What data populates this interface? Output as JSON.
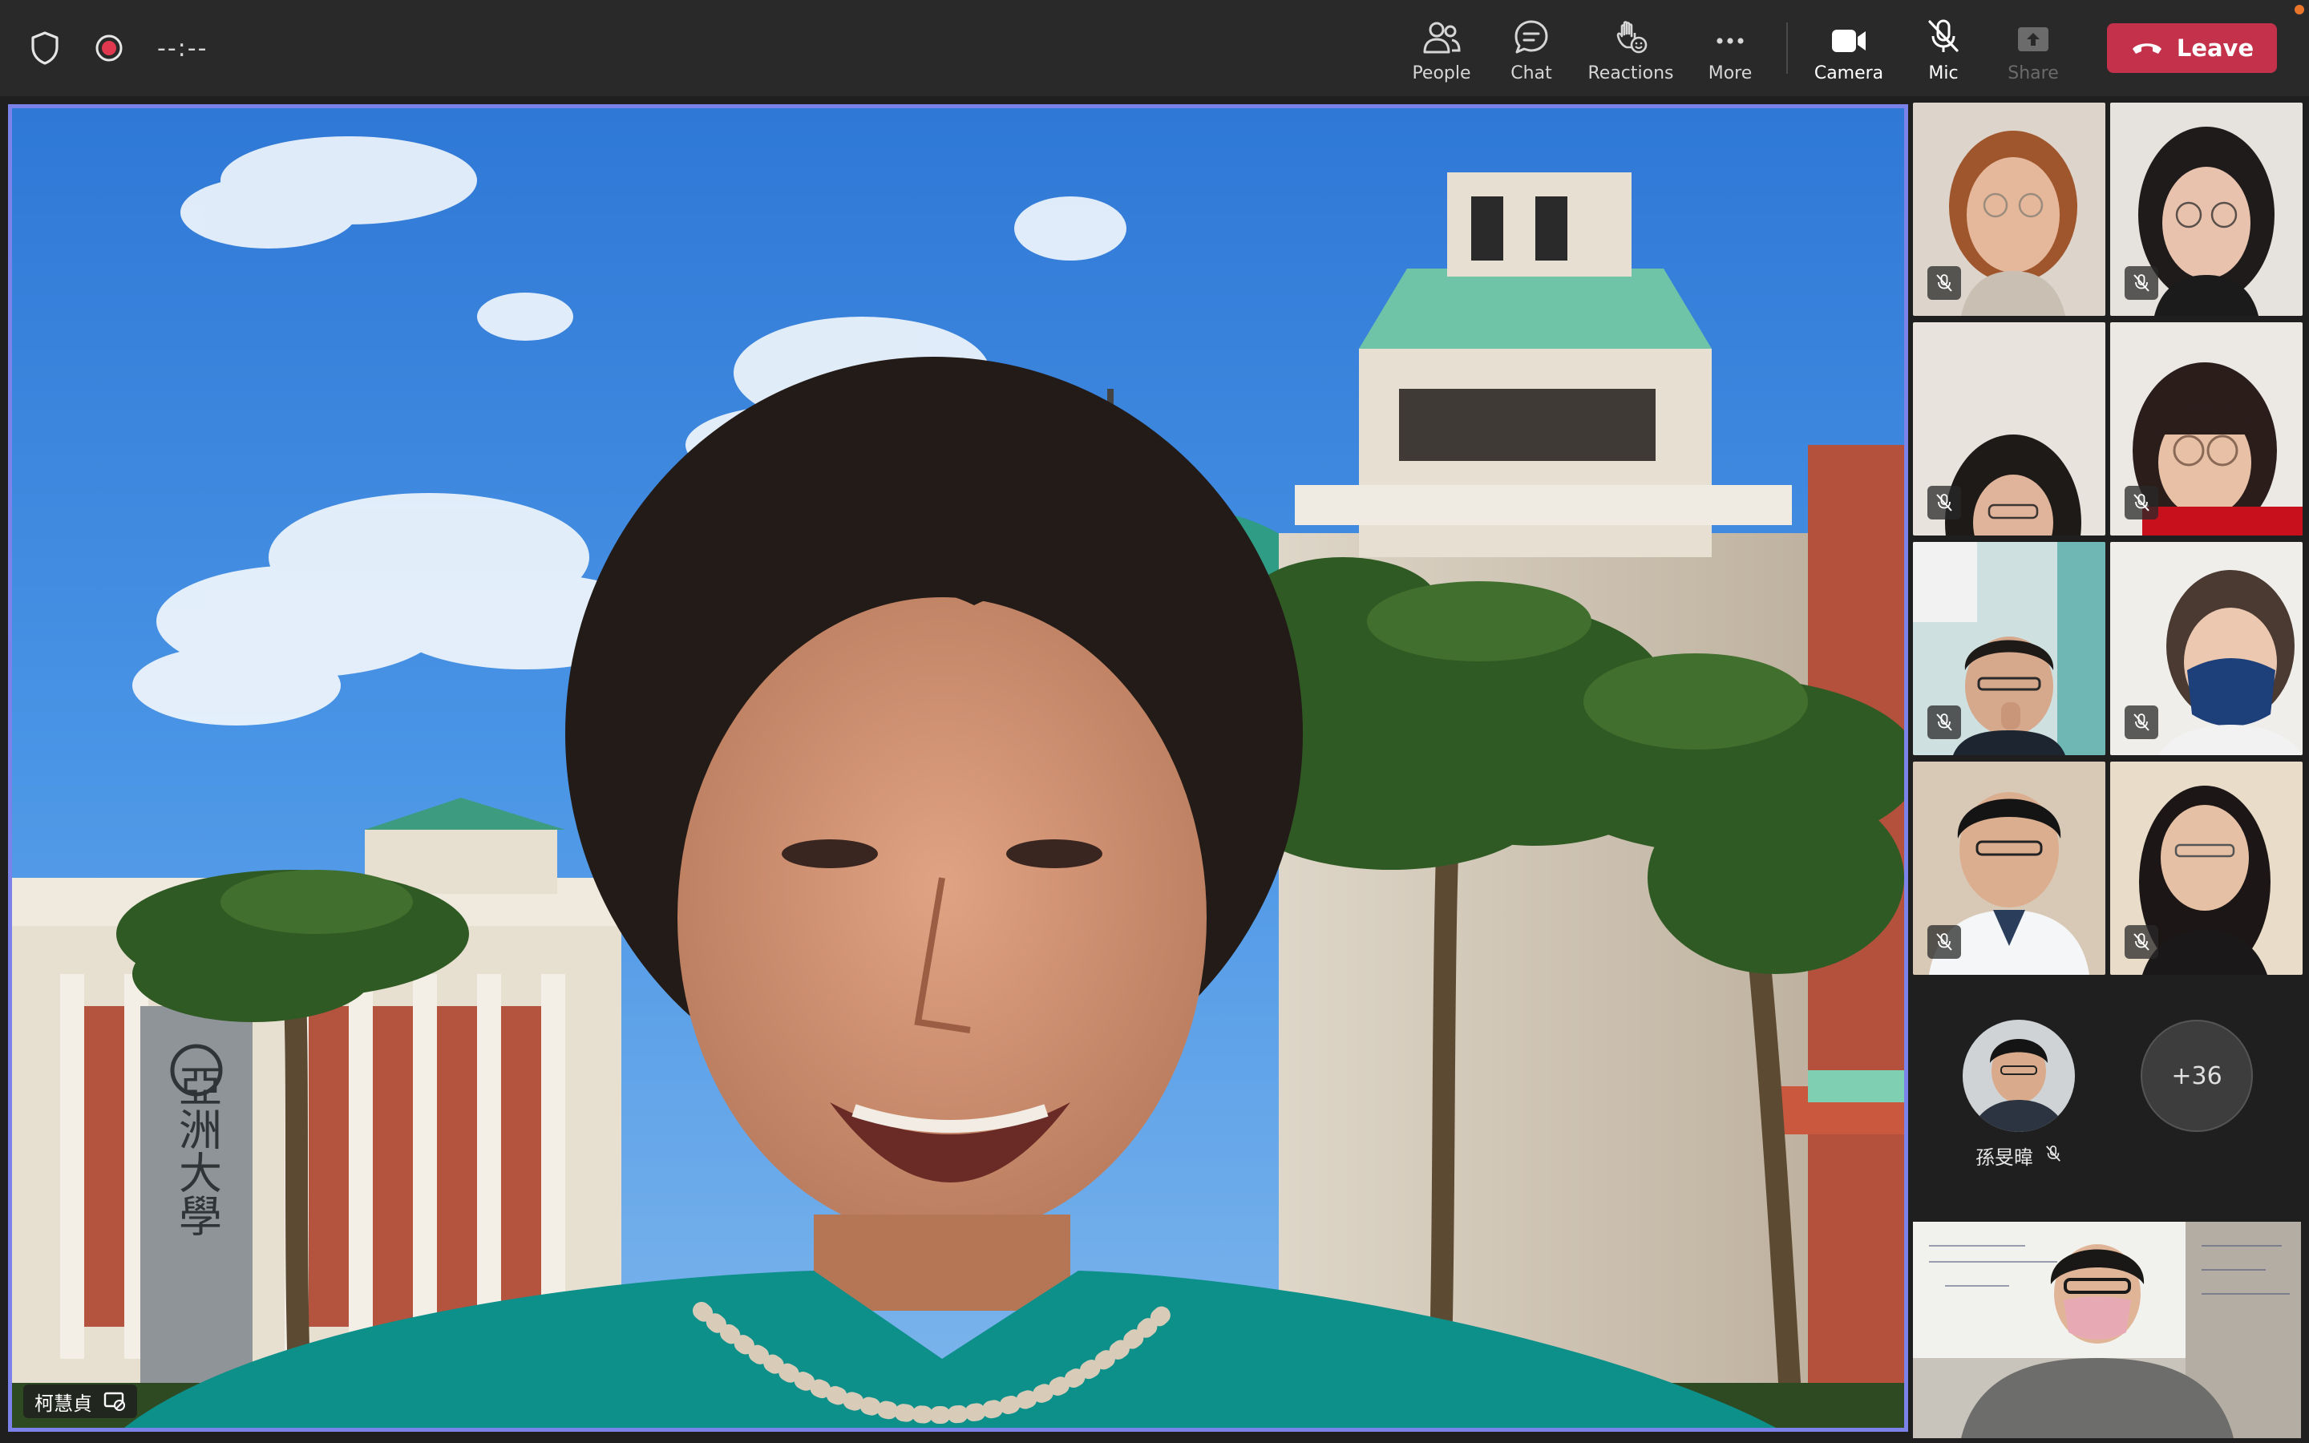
{
  "toolbar": {
    "timer": "--:--",
    "buttons": {
      "people": "People",
      "chat": "Chat",
      "reactions": "Reactions",
      "more": "More",
      "camera": "Camera",
      "mic": "Mic",
      "share": "Share"
    },
    "leave": "Leave",
    "icons": [
      "shield-icon",
      "record-icon",
      "people-icon",
      "chat-icon",
      "reactions-icon",
      "more-icon",
      "camera-icon",
      "mic-off-icon",
      "share-icon",
      "phone-hangup-icon"
    ]
  },
  "main_speaker": {
    "name": "柯慧貞",
    "sign_text": "亞洲大學"
  },
  "participants": {
    "tiles": [
      {
        "muted": true
      },
      {
        "muted": true
      },
      {
        "muted": true
      },
      {
        "muted": true
      },
      {
        "muted": true
      },
      {
        "muted": true
      },
      {
        "muted": true
      },
      {
        "muted": true
      }
    ],
    "audio_only": {
      "name": "孫旻暐",
      "muted": true
    },
    "overflow_count": "+36"
  },
  "colors": {
    "accent": "#7b83eb",
    "leave": "#c4314b",
    "toolbar_bg": "#292929",
    "stage_bg": "#1f1f1f"
  }
}
